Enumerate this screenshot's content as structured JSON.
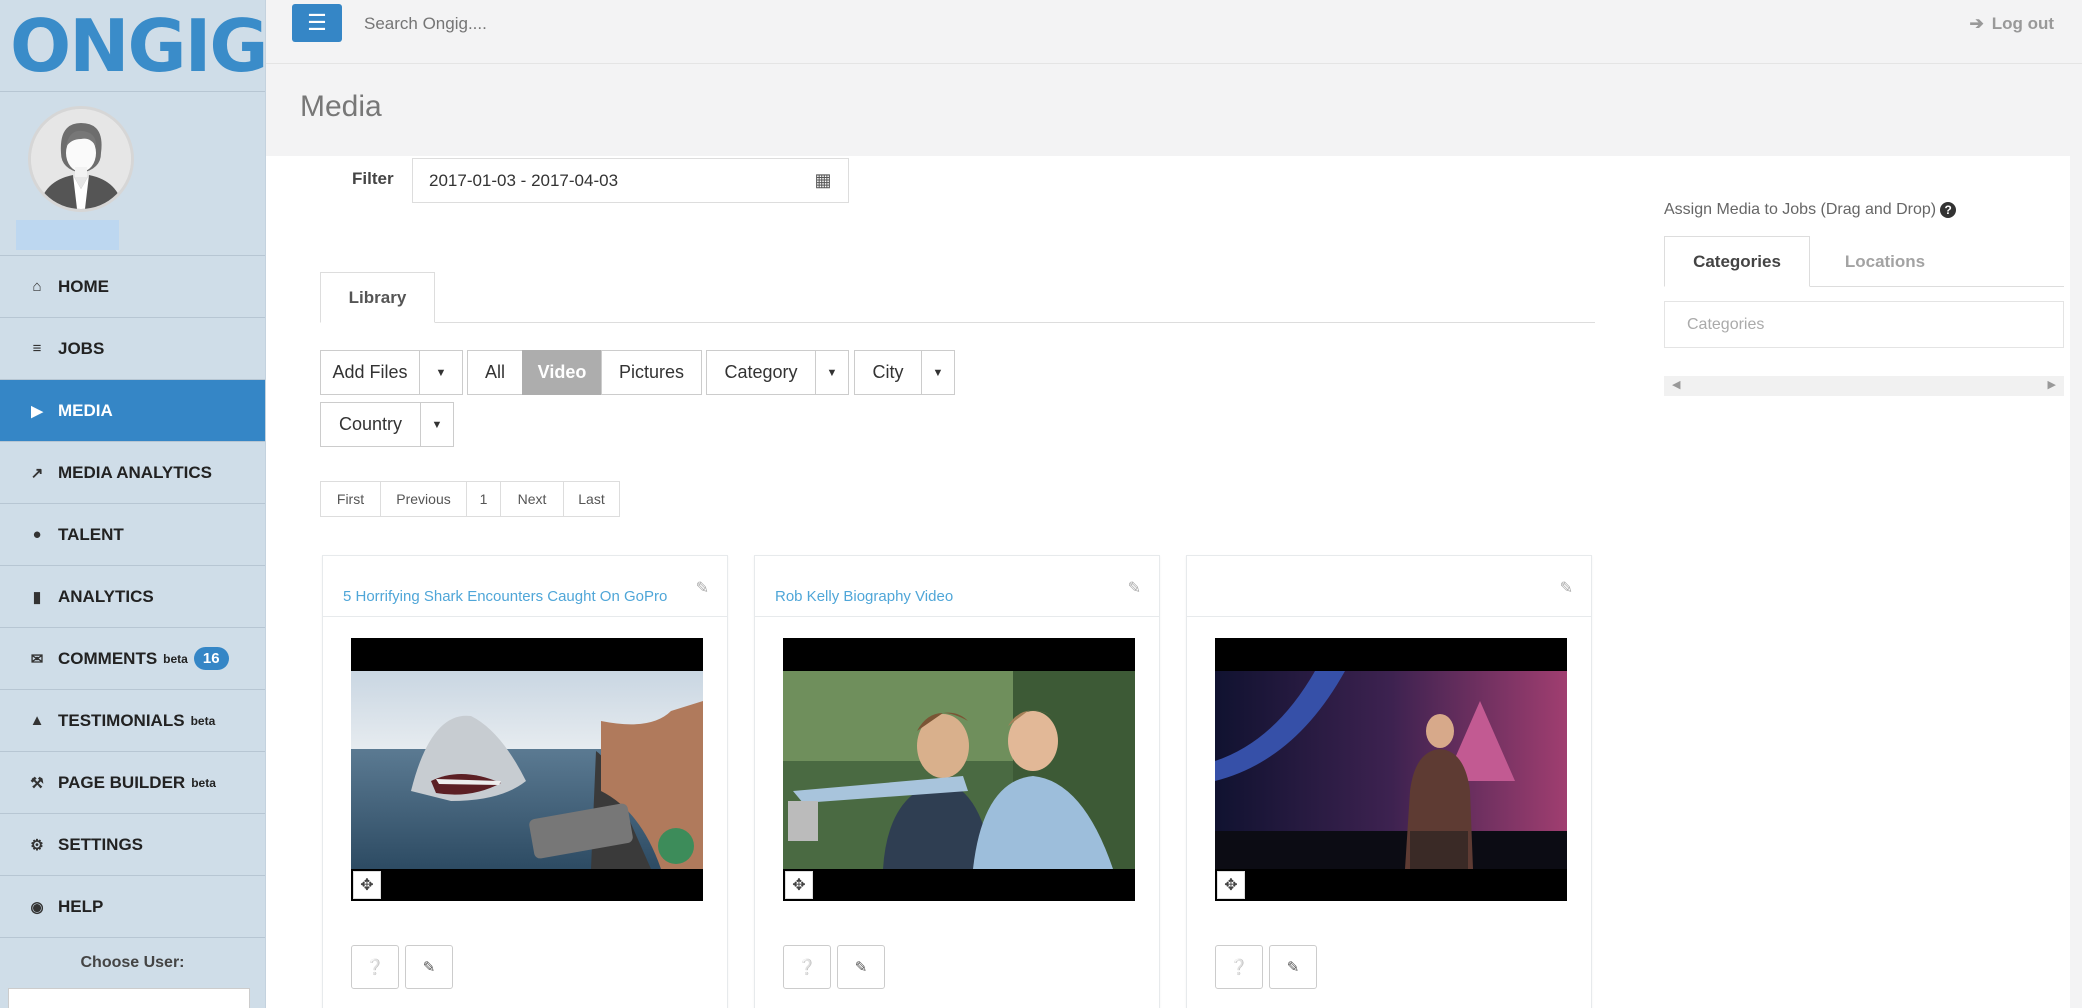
{
  "brand": {
    "logo_text": "ONGIG",
    "accent": "#3586c6"
  },
  "topbar": {
    "search_placeholder": "Search Ongig....",
    "logout_label": "Log out"
  },
  "sidebar": {
    "items": [
      {
        "label": "HOME",
        "icon": "home-icon"
      },
      {
        "label": "JOBS",
        "icon": "bars-icon"
      },
      {
        "label": "MEDIA",
        "icon": "video-camera-icon",
        "active": true
      },
      {
        "label": "MEDIA ANALYTICS",
        "icon": "line-chart-icon"
      },
      {
        "label": "TALENT",
        "icon": "users-icon"
      },
      {
        "label": "ANALYTICS",
        "icon": "bar-chart-icon"
      },
      {
        "label": "COMMENTS",
        "icon": "envelope-icon",
        "tag": "beta",
        "badge": "16"
      },
      {
        "label": "TESTIMONIALS",
        "icon": "thumbs-up-icon",
        "tag": "beta"
      },
      {
        "label": "PAGE BUILDER",
        "icon": "wrench-icon",
        "tag": "beta"
      },
      {
        "label": "SETTINGS",
        "icon": "gear-icon"
      },
      {
        "label": "HELP",
        "icon": "life-ring-icon"
      }
    ],
    "choose_user_label": "Choose User:"
  },
  "page": {
    "title": "Media"
  },
  "filter": {
    "label": "Filter",
    "value": "2017-01-03 - 2017-04-03"
  },
  "library_tab": "Library",
  "toolbar": {
    "add_files": "Add Files",
    "all": "All",
    "video": "Video",
    "pictures": "Pictures",
    "category": "Category",
    "city": "City",
    "country": "Country"
  },
  "pager": {
    "first": "First",
    "previous": "Previous",
    "current": "1",
    "next": "Next",
    "last": "Last"
  },
  "cards": [
    {
      "title": "5 Horrifying Shark Encounters Caught On GoPro"
    },
    {
      "title": "Rob Kelly Biography Video"
    },
    {
      "title": ""
    }
  ],
  "assign": {
    "title": "Assign Media to Jobs (Drag and Drop)",
    "tabs": [
      "Categories",
      "Locations"
    ],
    "categories_placeholder": "Categories"
  }
}
